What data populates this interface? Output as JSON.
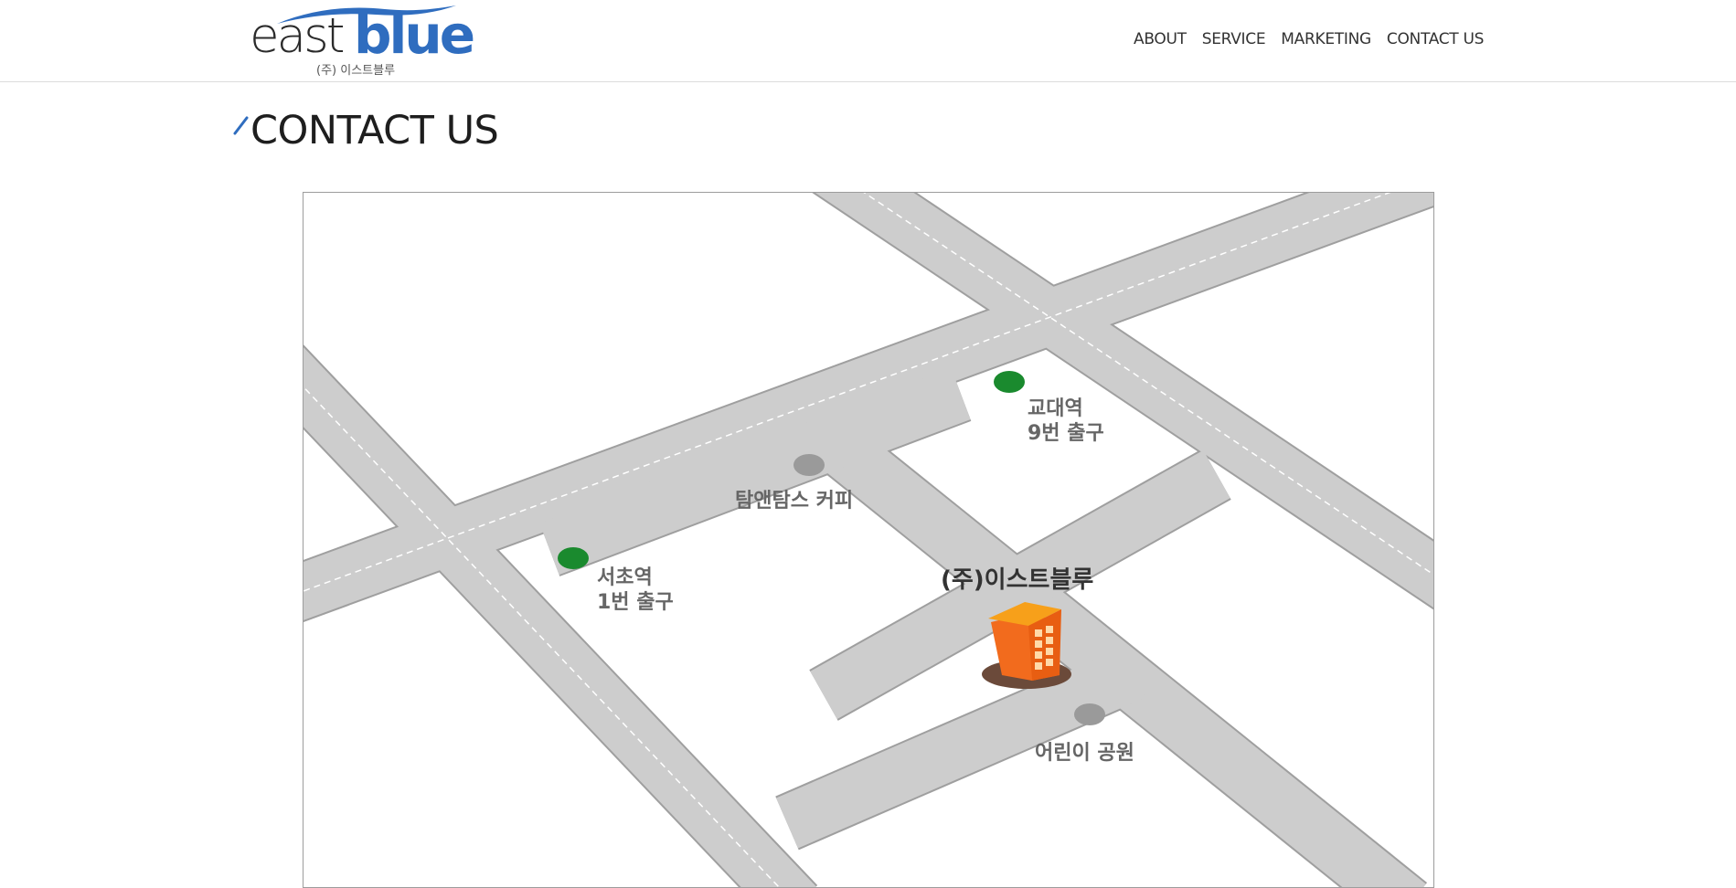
{
  "brand": {
    "logo_east": "east",
    "logo_blue": "blue",
    "logo_sub": "(주) 이스트블루",
    "accent_color": "#2f6dbf"
  },
  "nav": {
    "items": [
      "ABOUT",
      "SERVICE",
      "MARKETING",
      "CONTACT US"
    ]
  },
  "page": {
    "title": "CONTACT US"
  },
  "map": {
    "company": "(주)이스트블루",
    "landmarks": {
      "kyodae_line1": "교대역",
      "kyodae_line2": "9번 출구",
      "tomtoms": "탐앤탐스 커피",
      "seocho_line1": "서초역",
      "seocho_line2": "1번 출구",
      "park": "어린이 공원"
    },
    "colors": {
      "road": "#cccccc",
      "station_marker": "#1a8a2e",
      "landmark_marker": "#9a9a9a",
      "building": "#f26b1d"
    }
  }
}
